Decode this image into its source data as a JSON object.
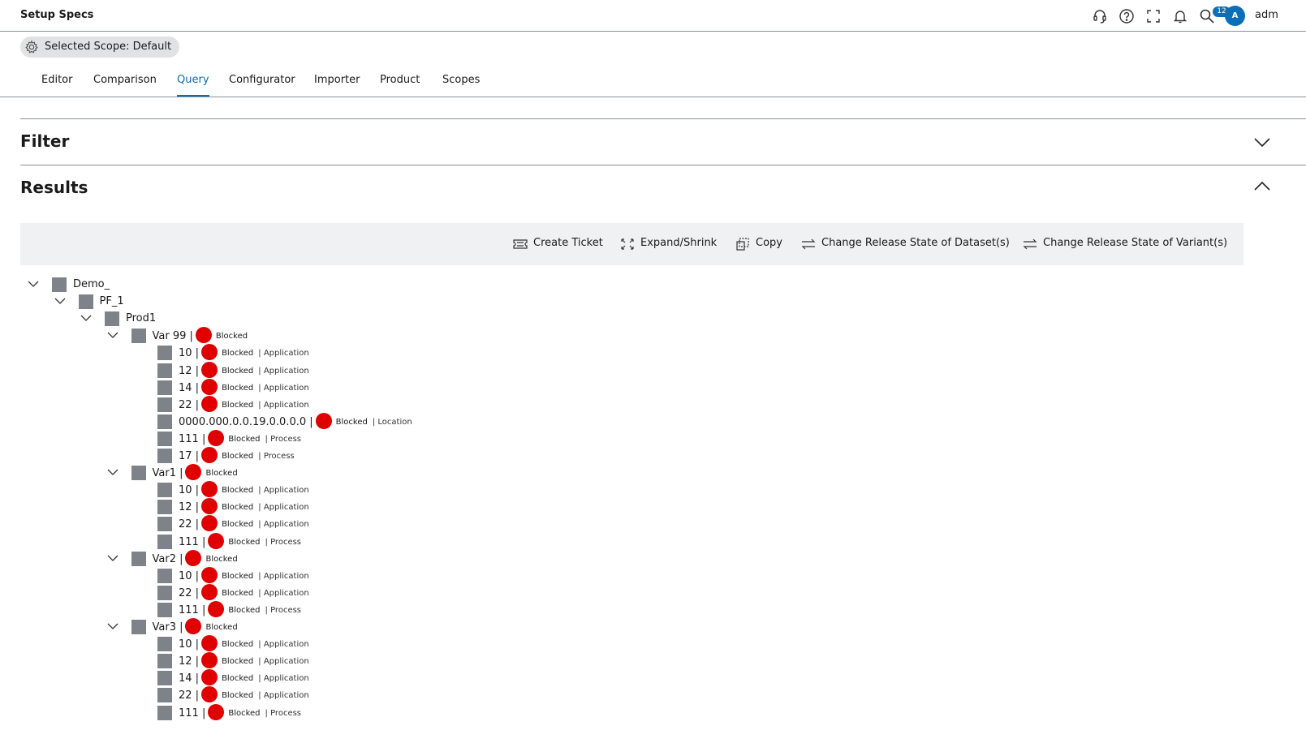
{
  "app": {
    "title": "Setup Specs",
    "notification_count": "12",
    "avatar_initial": "A",
    "user_name": "adm"
  },
  "scope": {
    "label": "Selected Scope: Default"
  },
  "tabs": [
    {
      "label": "Editor"
    },
    {
      "label": "Comparison"
    },
    {
      "label": "Query",
      "active": true
    },
    {
      "label": "Configurator"
    },
    {
      "label": "Importer"
    },
    {
      "label": "Product"
    },
    {
      "label": "Scopes"
    }
  ],
  "sections": {
    "filter": "Filter",
    "results": "Results"
  },
  "toolbar": {
    "create_ticket": "Create Ticket",
    "expand_shrink": "Expand/Shrink",
    "copy": "Copy",
    "change_dataset": "Change Release State of Dataset(s)",
    "change_variant": "Change Release State of Variant(s)"
  },
  "colors": {
    "accent": "#0a6fb8",
    "blocked": "#e00000",
    "node": "#7d8389",
    "toolbar_bg": "#eff1f2"
  },
  "tree": [
    {
      "level": 0,
      "label": "Demo_",
      "expandable": true
    },
    {
      "level": 1,
      "label": "PF_1",
      "expandable": true
    },
    {
      "level": 2,
      "label": "Prod1",
      "expandable": true
    },
    {
      "level": 3,
      "label": "Var 99 |",
      "expandable": true,
      "state": "Blocked"
    },
    {
      "level": 4,
      "label": "10 |",
      "state": "Blocked",
      "kind": "| Application"
    },
    {
      "level": 4,
      "label": "12 |",
      "state": "Blocked",
      "kind": "| Application"
    },
    {
      "level": 4,
      "label": "14 |",
      "state": "Blocked",
      "kind": "| Application"
    },
    {
      "level": 4,
      "label": "22 |",
      "state": "Blocked",
      "kind": "| Application"
    },
    {
      "level": 4,
      "label": "0000.000.0.0.19.0.0.0.0 |",
      "state": "Blocked",
      "kind": "| Location"
    },
    {
      "level": 4,
      "label": "111 |",
      "state": "Blocked",
      "kind": "| Process"
    },
    {
      "level": 4,
      "label": "17 |",
      "state": "Blocked",
      "kind": "| Process"
    },
    {
      "level": 3,
      "label": "Var1 |",
      "expandable": true,
      "state": "Blocked"
    },
    {
      "level": 4,
      "label": "10 |",
      "state": "Blocked",
      "kind": "| Application"
    },
    {
      "level": 4,
      "label": "12 |",
      "state": "Blocked",
      "kind": "| Application"
    },
    {
      "level": 4,
      "label": "22 |",
      "state": "Blocked",
      "kind": "| Application"
    },
    {
      "level": 4,
      "label": "111 |",
      "state": "Blocked",
      "kind": "| Process"
    },
    {
      "level": 3,
      "label": "Var2 |",
      "expandable": true,
      "state": "Blocked"
    },
    {
      "level": 4,
      "label": "10 |",
      "state": "Blocked",
      "kind": "| Application"
    },
    {
      "level": 4,
      "label": "22 |",
      "state": "Blocked",
      "kind": "| Application"
    },
    {
      "level": 4,
      "label": "111 |",
      "state": "Blocked",
      "kind": "| Process"
    },
    {
      "level": 3,
      "label": "Var3 |",
      "expandable": true,
      "state": "Blocked"
    },
    {
      "level": 4,
      "label": "10 |",
      "state": "Blocked",
      "kind": "| Application"
    },
    {
      "level": 4,
      "label": "12 |",
      "state": "Blocked",
      "kind": "| Application"
    },
    {
      "level": 4,
      "label": "14 |",
      "state": "Blocked",
      "kind": "| Application"
    },
    {
      "level": 4,
      "label": "22 |",
      "state": "Blocked",
      "kind": "| Application"
    },
    {
      "level": 4,
      "label": "111 |",
      "state": "Blocked",
      "kind": "| Process"
    }
  ]
}
